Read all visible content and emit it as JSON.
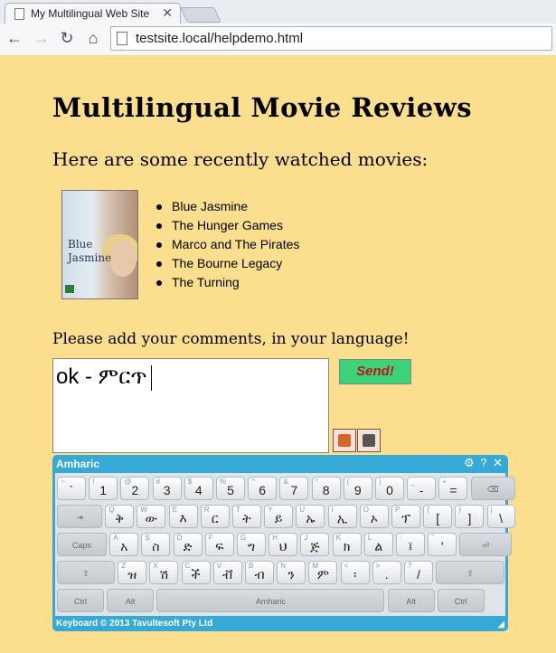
{
  "browser": {
    "tab_title": "My Multilingual Web Site",
    "tab_close": "✕",
    "url": "testsite.local/helpdemo.html",
    "nav": {
      "back": "←",
      "forward": "→",
      "reload": "↻",
      "home": "⌂"
    }
  },
  "page": {
    "title": "Multilingual Movie Reviews",
    "subtitle": "Here are some recently watched movies:",
    "poster_text": "Blue\nJasmine",
    "movies": [
      "Blue Jasmine",
      "The Hunger Games",
      "Marco and The Pirates",
      "The Bourne Legacy",
      "The Turning"
    ],
    "comment_label": "Please add your comments, in your language!",
    "comment_value": "ok - ምርጥ",
    "send_label": "Send!"
  },
  "keyboard": {
    "title": "Amharic",
    "controls": {
      "settings": "⚙",
      "help": "?",
      "close": "✕"
    },
    "footer": "Keyboard © 2013 Tavultesoft Pty Ltd",
    "rows": [
      [
        {
          "s": "~",
          "m": "`"
        },
        {
          "s": "!",
          "m": "1"
        },
        {
          "s": "@",
          "m": "2"
        },
        {
          "s": "#",
          "m": "3"
        },
        {
          "s": "$",
          "m": "4"
        },
        {
          "s": "%",
          "m": "5"
        },
        {
          "s": "^",
          "m": "6"
        },
        {
          "s": "&",
          "m": "7"
        },
        {
          "s": "*",
          "m": "8"
        },
        {
          "s": "(",
          "m": "9"
        },
        {
          "s": ")",
          "m": "0"
        },
        {
          "s": "_",
          "m": "-"
        },
        {
          "s": "+",
          "m": "="
        },
        {
          "s": "",
          "m": "⌫",
          "fn": true
        }
      ],
      [
        {
          "s": "",
          "m": "⇥",
          "fn": true
        },
        {
          "s": "Q",
          "m": "ቅ"
        },
        {
          "s": "W",
          "m": "ው"
        },
        {
          "s": "E",
          "m": "እ"
        },
        {
          "s": "R",
          "m": "ር"
        },
        {
          "s": "T",
          "m": "ት"
        },
        {
          "s": "Y",
          "m": "ይ"
        },
        {
          "s": "U",
          "m": "ኡ"
        },
        {
          "s": "I",
          "m": "ኢ"
        },
        {
          "s": "O",
          "m": "ኦ"
        },
        {
          "s": "P",
          "m": "ፕ"
        },
        {
          "s": "{",
          "m": "["
        },
        {
          "s": "}",
          "m": "]"
        },
        {
          "s": "|",
          "m": "\\"
        }
      ],
      [
        {
          "s": "",
          "m": "Caps",
          "fn": true
        },
        {
          "s": "A",
          "m": "አ"
        },
        {
          "s": "S",
          "m": "ስ"
        },
        {
          "s": "D",
          "m": "ድ"
        },
        {
          "s": "F",
          "m": "ፍ"
        },
        {
          "s": "G",
          "m": "ግ"
        },
        {
          "s": "H",
          "m": "ህ"
        },
        {
          "s": "J",
          "m": "ጅ"
        },
        {
          "s": "K",
          "m": "ክ"
        },
        {
          "s": "L",
          "m": "ል"
        },
        {
          "s": ":",
          "m": "፤"
        },
        {
          "s": "\"",
          "m": "'"
        },
        {
          "s": "",
          "m": "⏎",
          "fn": true
        }
      ],
      [
        {
          "s": "",
          "m": "⇧",
          "fn": true
        },
        {
          "s": "Z",
          "m": "ዝ"
        },
        {
          "s": "X",
          "m": "ሽ"
        },
        {
          "s": "C",
          "m": "ች"
        },
        {
          "s": "V",
          "m": "ቭ"
        },
        {
          "s": "B",
          "m": "ብ"
        },
        {
          "s": "N",
          "m": "ን"
        },
        {
          "s": "M",
          "m": "ም"
        },
        {
          "s": "<",
          "m": "፡"
        },
        {
          "s": ">",
          "m": "."
        },
        {
          "s": "?",
          "m": "/"
        },
        {
          "s": "",
          "m": "⇧",
          "fn": true
        }
      ],
      [
        {
          "s": "",
          "m": "Ctrl",
          "fn": true
        },
        {
          "s": "",
          "m": "Alt",
          "fn": true
        },
        {
          "s": "",
          "m": "Amharic",
          "fn": true
        },
        {
          "s": "",
          "m": "Alt",
          "fn": true
        },
        {
          "s": "",
          "m": "Ctrl",
          "fn": true
        }
      ]
    ]
  }
}
